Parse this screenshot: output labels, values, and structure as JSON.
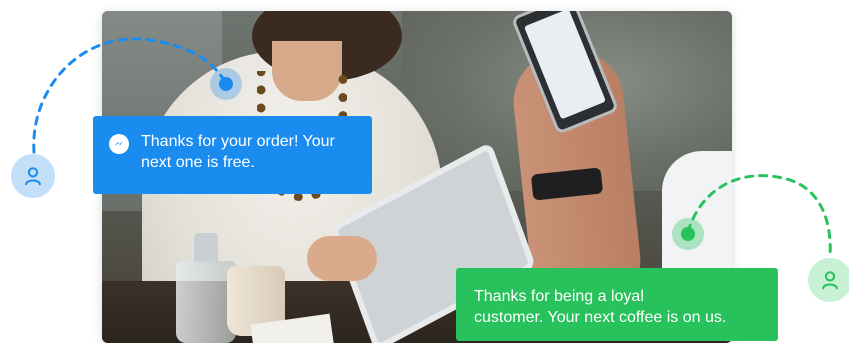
{
  "messages": {
    "messenger": {
      "text_line1": "Thanks for your order! Your",
      "text_line2": "next one is free.",
      "icon": "messenger-icon",
      "color": "#1a8cf0"
    },
    "sms": {
      "text_line1": "Thanks for being a loyal",
      "text_line2": "customer. Your next coffee is on us.",
      "color": "#27c25b"
    }
  },
  "avatars": {
    "blue": {
      "icon": "user-icon",
      "color": "#c4e0f9"
    },
    "green": {
      "icon": "user-icon",
      "color": "#c8f0d4"
    }
  },
  "accents": {
    "blue": "#1a8cf0",
    "green": "#27c25b"
  }
}
